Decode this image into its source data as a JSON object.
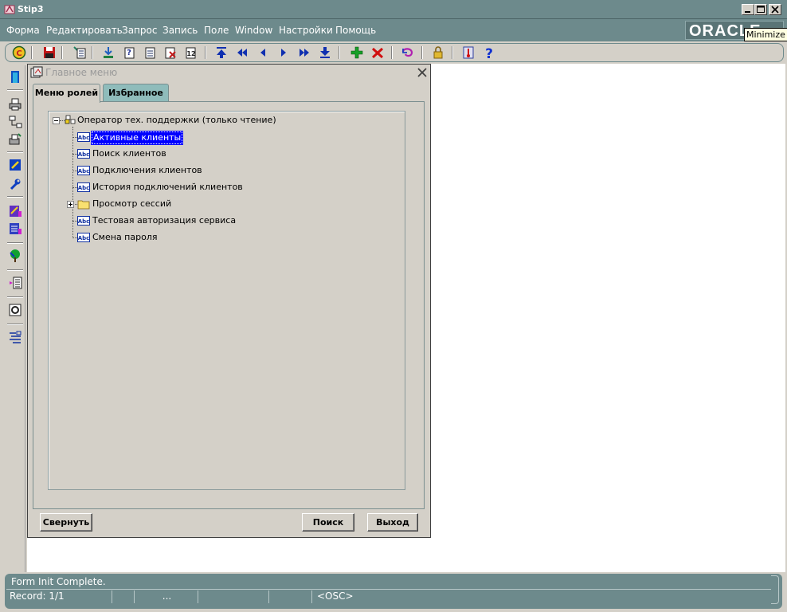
{
  "window": {
    "title": "Stip3",
    "tooltip": "Minimize",
    "brand_logo": "ORACLE"
  },
  "menu": {
    "items": [
      "Форма",
      "Редактировать",
      "Запрос",
      "Запись",
      "Поле",
      "Window",
      "Настройки",
      "Помощь"
    ]
  },
  "toolbar": {
    "icons": [
      "copyright-icon",
      "save-icon",
      "print-icon",
      "enter-query-icon",
      "execute-query-icon",
      "cancel-query-icon",
      "count-query-icon",
      "first-record-icon",
      "previous-block-icon",
      "previous-record-icon",
      "next-record-icon",
      "next-block-icon",
      "last-record-icon",
      "insert-record-icon",
      "delete-record-icon",
      "rollback-icon",
      "lock-icon",
      "thermometer-icon",
      "help-icon"
    ]
  },
  "internal_window": {
    "title": "Главное меню",
    "tabs": [
      {
        "label": "Меню ролей",
        "active": true
      },
      {
        "label": "Избранное",
        "active": false
      }
    ],
    "tree": {
      "root": "Оператор тех. поддержки (только чтение)",
      "items": [
        {
          "label": "Активные клиенты",
          "type": "form",
          "selected": true
        },
        {
          "label": "Поиск клиентов",
          "type": "form",
          "selected": false
        },
        {
          "label": "Подключения клиентов",
          "type": "form",
          "selected": false
        },
        {
          "label": "История подключений клиентов",
          "type": "form",
          "selected": false
        },
        {
          "label": "Просмотр сессий",
          "type": "folder",
          "selected": false
        },
        {
          "label": "Тестовая авторизация сервиса",
          "type": "form",
          "selected": false
        },
        {
          "label": "Смена пароля",
          "type": "form",
          "selected": false
        }
      ]
    },
    "buttons": {
      "collapse": "Свернуть",
      "search": "Поиск",
      "exit": "Выход"
    }
  },
  "status": {
    "message": "Form Init Complete.",
    "record": "Record: 1/1",
    "ellipsis": "...",
    "mode": "<OSC>"
  },
  "colors": {
    "chrome": "#6d8a8c",
    "selection": "#0000ff",
    "inactive_tab": "#8fbcbb"
  }
}
